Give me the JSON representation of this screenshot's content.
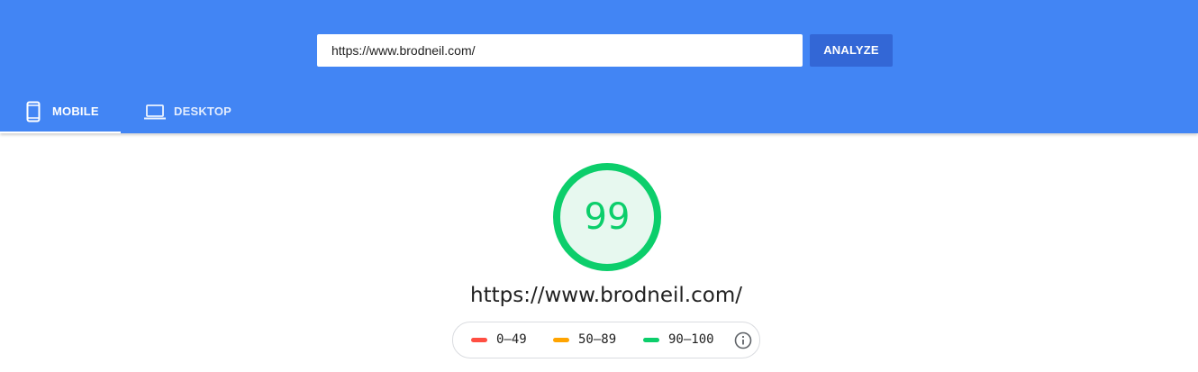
{
  "search": {
    "url_value": "https://www.brodneil.com/",
    "analyze_label": "ANALYZE"
  },
  "tabs": [
    {
      "label": "MOBILE",
      "icon": "mobile-phone-icon",
      "active": true
    },
    {
      "label": "DESKTOP",
      "icon": "laptop-icon",
      "active": false
    }
  ],
  "result": {
    "score": "99",
    "url": "https://www.brodneil.com/"
  },
  "legend": [
    {
      "range": "0–49",
      "color": "#ff4e42"
    },
    {
      "range": "50–89",
      "color": "#ffa400"
    },
    {
      "range": "90–100",
      "color": "#0cce6b"
    }
  ],
  "colors": {
    "header": "#4285f4",
    "button": "#3367d6",
    "pass": "#0cce6b",
    "pass_fill": "#e7f8ef"
  },
  "icons": {
    "info": "info-icon"
  }
}
